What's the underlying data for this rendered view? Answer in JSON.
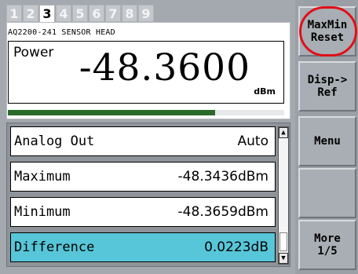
{
  "tabs": [
    "1",
    "2",
    "3",
    "4",
    "5",
    "6",
    "7",
    "8",
    "9"
  ],
  "active_tab": "3",
  "sensor_label": "AQ2200-241 SENSOR HEAD",
  "power": {
    "label": "Power",
    "value": "-48.3600",
    "unit": "dBm",
    "level_fraction": 0.75
  },
  "list": [
    {
      "label": "Analog Out",
      "value": "Auto"
    },
    {
      "label": "Maximum",
      "value": "-48.3436dBm"
    },
    {
      "label": "Minimum",
      "value": "-48.3659dBm"
    },
    {
      "label": "Difference",
      "value": "0.0223dB"
    }
  ],
  "selected_row_label": "Difference",
  "scroll": {
    "up_icon": "triangle-up",
    "down_icon": "triangle-down"
  },
  "softkeys": [
    {
      "label": "MaxMin\nReset"
    },
    {
      "label": "Disp->\nRef"
    },
    {
      "label": "Menu"
    },
    {
      "label": ""
    },
    {
      "label": "More\n1/5"
    }
  ],
  "colors": {
    "selected_row": "#57c6d8",
    "level_bar": "#2a6b2a",
    "highlight": "#e0101a"
  }
}
